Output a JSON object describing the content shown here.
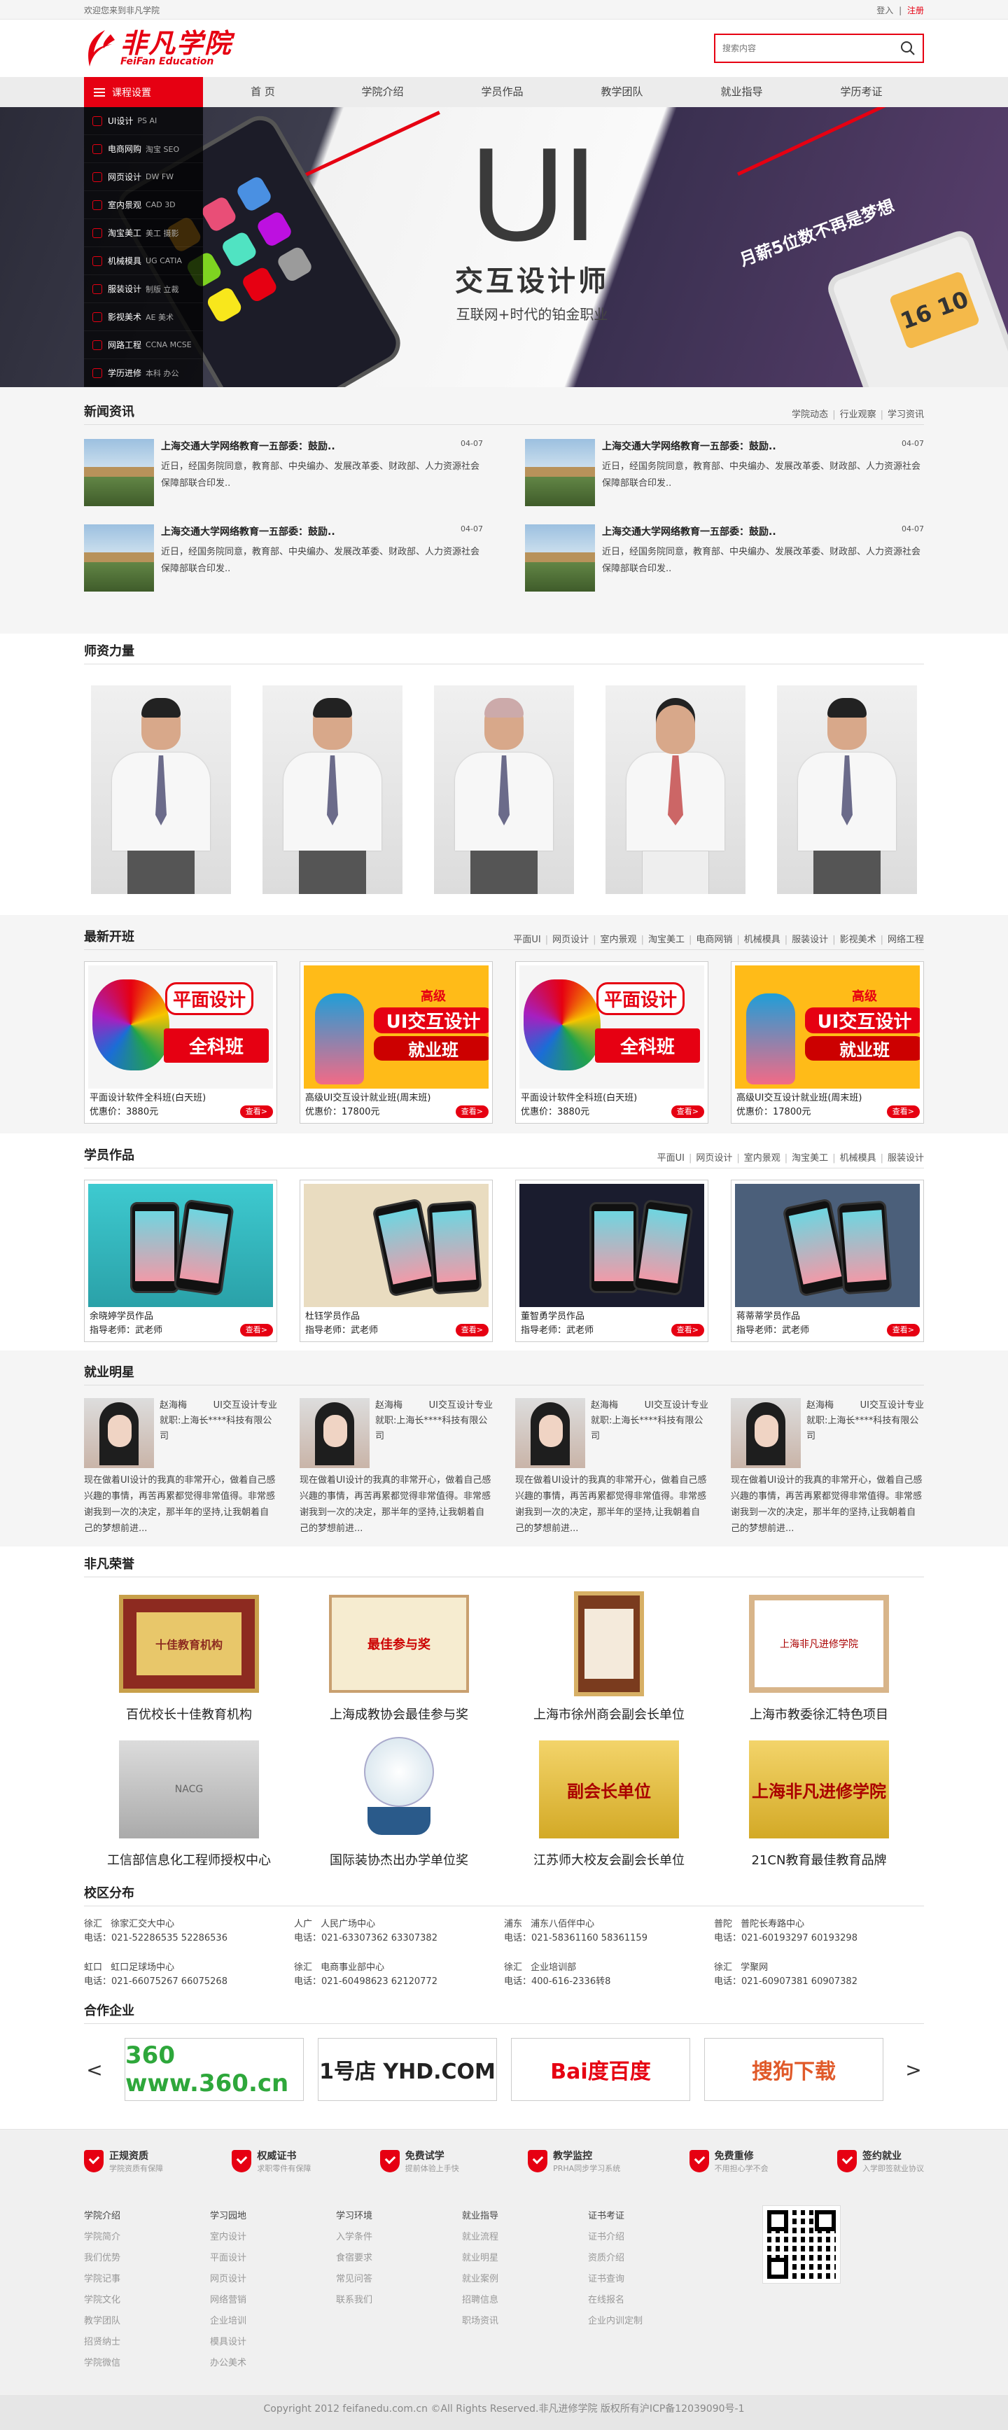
{
  "topbar": {
    "welcome": "欢迎您来到非凡学院",
    "login": "登入",
    "sep": "|",
    "register": "注册"
  },
  "logo": {
    "cn": "非凡学院",
    "en": "FeiFan Education"
  },
  "search": {
    "placeholder": "搜索内容"
  },
  "nav": {
    "menu_title": "课程设置",
    "items": [
      "首 页",
      "学院介绍",
      "学员作品",
      "教学团队",
      "就业指导",
      "学历考证"
    ]
  },
  "side_menu": [
    {
      "label": "UI设计",
      "sub": "PS AI"
    },
    {
      "label": "电商网购",
      "sub": "淘宝 SEO"
    },
    {
      "label": "网页设计",
      "sub": "DW FW"
    },
    {
      "label": "室内景观",
      "sub": "CAD 3D"
    },
    {
      "label": "淘宝美工",
      "sub": "美工 摄影"
    },
    {
      "label": "机械模具",
      "sub": "UG CATIA"
    },
    {
      "label": "服装设计",
      "sub": "制版 立裁"
    },
    {
      "label": "影视美术",
      "sub": "AE 美术"
    },
    {
      "label": "网路工程",
      "sub": "CCNA MCSE"
    },
    {
      "label": "学历进修",
      "sub": "本科 办公"
    }
  ],
  "banner": {
    "big": "UI",
    "title": "交互设计师",
    "subtitle": "互联网+时代的铂金职业",
    "tag": "月薪5位数不再是梦想",
    "clock": "16 10"
  },
  "news": {
    "title": "新闻资讯",
    "links": [
      "学院动态",
      "行业观察",
      "学习资讯"
    ],
    "items": [
      {
        "title": "上海交通大学网络教育一五部委：鼓励..",
        "date": "04-07",
        "desc": "近日，经国务院同意，教育部、中央编办、发展改革委、财政部、人力资源社会保障部联合印发.."
      },
      {
        "title": "上海交通大学网络教育一五部委：鼓励..",
        "date": "04-07",
        "desc": "近日，经国务院同意，教育部、中央编办、发展改革委、财政部、人力资源社会保障部联合印发.."
      },
      {
        "title": "上海交通大学网络教育一五部委：鼓励..",
        "date": "04-07",
        "desc": "近日，经国务院同意，教育部、中央编办、发展改革委、财政部、人力资源社会保障部联合印发.."
      },
      {
        "title": "上海交通大学网络教育一五部委：鼓励..",
        "date": "04-07",
        "desc": "近日，经国务院同意，教育部、中央编办、发展改革委、财政部、人力资源社会保障部联合印发.."
      }
    ]
  },
  "teachers": {
    "title": "师资力量"
  },
  "courses": {
    "title": "最新开班",
    "links": [
      "平面UI",
      "网页设计",
      "室内景观",
      "淘宝美工",
      "电商网销",
      "机械模具",
      "服装设计",
      "影视美术",
      "网络工程"
    ],
    "items": [
      {
        "name": "平面设计软件全科班(白天班)",
        "price": "优惠价：3880元",
        "btn": "查看>",
        "poster_a": "平面设计",
        "poster_b": "全科班"
      },
      {
        "name": "高级UI交互设计就业班(周末班)",
        "price": "优惠价：17800元",
        "btn": "查看>",
        "poster_a": "高级",
        "poster_b": "UI交互设计",
        "poster_c": "就业班"
      },
      {
        "name": "平面设计软件全科班(白天班)",
        "price": "优惠价：3880元",
        "btn": "查看>",
        "poster_a": "平面设计",
        "poster_b": "全科班"
      },
      {
        "name": "高级UI交互设计就业班(周末班)",
        "price": "优惠价：17800元",
        "btn": "查看>",
        "poster_a": "高级",
        "poster_b": "UI交互设计",
        "poster_c": "就业班"
      }
    ]
  },
  "works": {
    "title": "学员作品",
    "links": [
      "平面UI",
      "网页设计",
      "室内景观",
      "淘宝美工",
      "机械模具",
      "服装设计"
    ],
    "items": [
      {
        "name": "余晓婷学员作品",
        "teacher": "指导老师：武老师",
        "btn": "查看>"
      },
      {
        "name": "杜钰学员作品",
        "teacher": "指导老师：武老师",
        "btn": "查看>"
      },
      {
        "name": "董智勇学员作品",
        "teacher": "指导老师：武老师",
        "btn": "查看>"
      },
      {
        "name": "蒋蒂蒂学员作品",
        "teacher": "指导老师：武老师",
        "btn": "查看>"
      }
    ]
  },
  "stars": {
    "title": "就业明星",
    "items": [
      {
        "name": "赵海梅",
        "role": "UI交互设计专业",
        "job": "就职:上海长****科技有限公司",
        "story": "现在做着UI设计的我真的非常开心，做着自己感兴趣的事情，再苦再累都觉得非常值得。非常感谢我到一次的决定，那半年的坚持,让我朝着自己的梦想前进..."
      },
      {
        "name": "赵海梅",
        "role": "UI交互设计专业",
        "job": "就职:上海长****科技有限公司",
        "story": "现在做着UI设计的我真的非常开心，做着自己感兴趣的事情，再苦再累都觉得非常值得。非常感谢我到一次的决定，那半年的坚持,让我朝着自己的梦想前进..."
      },
      {
        "name": "赵海梅",
        "role": "UI交互设计专业",
        "job": "就职:上海长****科技有限公司",
        "story": "现在做着UI设计的我真的非常开心，做着自己感兴趣的事情，再苦再累都觉得非常值得。非常感谢我到一次的决定，那半年的坚持,让我朝着自己的梦想前进..."
      },
      {
        "name": "赵海梅",
        "role": "UI交互设计专业",
        "job": "就职:上海长****科技有限公司",
        "story": "现在做着UI设计的我真的非常开心，做着自己感兴趣的事情，再苦再累都觉得非常值得。非常感谢我到一次的决定，那半年的坚持,让我朝着自己的梦想前进..."
      }
    ]
  },
  "honors": {
    "title": "非凡荣誉",
    "items": [
      "百优校长十佳教育机构",
      "上海成教协会最佳参与奖",
      "上海市徐州商会副会长单位",
      "上海市教委徐汇特色项目",
      "工信部信息化工程师授权中心",
      "国际装协杰出办学单位奖",
      "江苏师大校友会副会长单位",
      "21CN教育最佳教育品牌"
    ],
    "plaque_texts": [
      "十佳教育机构",
      "最佳参与奖",
      "",
      "上海非凡进修学院",
      "NACG",
      "",
      "副会长单位",
      "上海非凡进修学院"
    ]
  },
  "campus": {
    "title": "校区分布",
    "items": [
      {
        "area": "徐汇",
        "name": "徐家汇交大中心",
        "phone": "电话：021-52286535 52286536"
      },
      {
        "area": "人广",
        "name": "人民广场中心",
        "phone": "电话：021-63307362 63307382"
      },
      {
        "area": "浦东",
        "name": "浦东八佰伴中心",
        "phone": "电话：021-58361160 58361159"
      },
      {
        "area": "普陀",
        "name": "普陀长寿路中心",
        "phone": "电话：021-60193297 60193298"
      },
      {
        "area": "虹口",
        "name": "虹口足球场中心",
        "phone": "电话：021-66075267 66075268"
      },
      {
        "area": "徐汇",
        "name": "电商事业部中心",
        "phone": "电话：021-60498623 62120772"
      },
      {
        "area": "徐汇",
        "name": "企业培训部",
        "phone": "电话：400-616-2336转8"
      },
      {
        "area": "徐汇",
        "name": "学聚网",
        "phone": "电话：021-60907381 60907382"
      }
    ]
  },
  "partners": {
    "title": "合作企业",
    "prev": "<",
    "next": ">",
    "logos": [
      "360 www.360.cn",
      "1号店 YHD.COM",
      "Bai度百度",
      "搜狗下载"
    ]
  },
  "footer_bar": [
    {
      "t": "正规资质",
      "s": "学院资质有保障"
    },
    {
      "t": "权威证书",
      "s": "求职零件有保障"
    },
    {
      "t": "免费试学",
      "s": "提前体验上手快"
    },
    {
      "t": "教学监控",
      "s": "PRHA同步学习系统"
    },
    {
      "t": "免费重修",
      "s": "不用担心学不会"
    },
    {
      "t": "签约就业",
      "s": "入学即签就业协议"
    }
  ],
  "footer_cols": [
    {
      "h": "学院介绍",
      "items": [
        "学院简介",
        "我们优势",
        "学院记事",
        "学院文化",
        "教学团队",
        "招贤纳士",
        "学院微信"
      ]
    },
    {
      "h": "学习园地",
      "items": [
        "室内设计",
        "平面设计",
        "网页设计",
        "网络营销",
        "企业培训",
        "模具设计",
        "办公美术"
      ]
    },
    {
      "h": "学习环境",
      "items": [
        "入学条件",
        "食宿要求",
        "常见问答",
        "联系我们"
      ]
    },
    {
      "h": "就业指导",
      "items": [
        "就业流程",
        "就业明星",
        "就业案例",
        "招聘信息",
        "职场资讯"
      ]
    },
    {
      "h": "证书考证",
      "items": [
        "证书介绍",
        "资质介绍",
        "证书查询",
        "在线报名",
        "企业内训定制"
      ]
    }
  ],
  "copyright": "Copyright 2012 feifanedu.com.cn ©All Rights Reserved.非凡进修学院 版权所有沪ICP备12039090号-1",
  "colors": {
    "accent": "#e60012"
  }
}
